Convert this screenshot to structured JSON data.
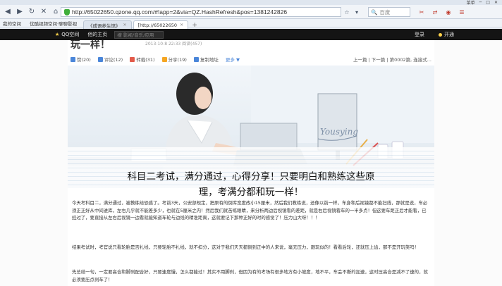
{
  "browser": {
    "title_strip": {
      "menu": "菜单",
      "min": "─",
      "max": "□",
      "close": "✕"
    },
    "url": "http://65022650.qzone.qq.com/#!app=2&via=QZ.HashRefresh&pos=1381242826",
    "search_placeholder": "百度",
    "bookmarks": [
      "我的空间",
      "优酷视频空间·聊聊影视"
    ],
    "tabs": [
      {
        "label": "《成语养生馆》",
        "active": false
      },
      {
        "label": "[http://65022650",
        "active": true
      }
    ],
    "new_tab": "+"
  },
  "qzone": {
    "logo": "QQ空间",
    "home": "他的主页",
    "search_placeholder": "搜 影视/音乐/应用",
    "login": "登录",
    "user": "开通"
  },
  "post": {
    "title": "玩一样！",
    "meta": "2013-10-8 22:33   阅读(457)",
    "actions": [
      {
        "label": "赞(20)",
        "color": "#4a86d9"
      },
      {
        "label": "评论(12)",
        "color": "#4a86d9"
      },
      {
        "label": "转载(31)",
        "color": "#e25a4a"
      },
      {
        "label": "分享(19)",
        "color": "#f5a623"
      },
      {
        "label": "复制地址",
        "color": "#4a86d9"
      },
      {
        "label": "更多 ▼",
        "color": "#4a86d9"
      }
    ],
    "pager": "上一篇 | 下一篇 | 第0002篇, 连接式...",
    "banner_text": "Yousying",
    "big_title_line1": "科目二考试，满分通过，心得分享！只要明白和熟练这些原",
    "big_title_line2": "理，考满分都和玩一样！",
    "paragraphs": [
      "今天考科目二，满分通过，被教练给恐惑了。考前3天，公安部规定，把原有的倒库宽度改小15厘米，然后我们教练说，还像以前一样，车身和后视镜都不能扫线，那就是说，车必须正正好从中间进库，左右几乎就不能差多少，也就在5厘米之内！然后我们就苦练眼睛，来分析两边后视镜看的差距，就是右后视镜看车的一半多点！但这要车距正后才能看，已经过了，要直接从左右后视镜一边看就能知道车轮与边线的精准距离，这就要记下那种正好的时的感觉了！压力山大呀！！！",
      "结果考试时，考官说只看轮胎是否扎线，只要轮胎不扎线，就不扣分，这对于我们天天都倒到正中的人来说，毫无压力，跟玩似的！看看后轮，还就压上齿，那不是开玩笑吗！",
      "先总结一句，一定要高合和脚刹配合好，只要速度慢，怎么都能过！其实不用脚刹，但因为有的考场有很多地方有小坡度，地不平，车会不断的加速，这时压高合是减不了速的，就必须要压点刹车了！"
    ]
  }
}
